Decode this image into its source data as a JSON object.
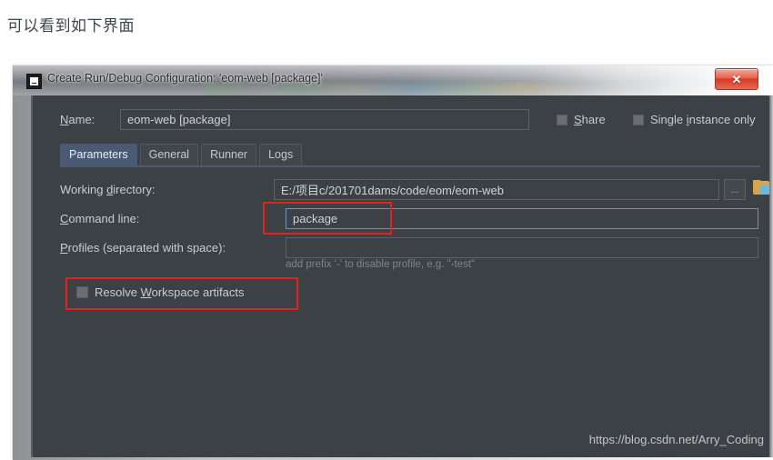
{
  "page": {
    "heading": "可以看到如下界面"
  },
  "window": {
    "title": "Create Run/Debug Configuration: 'eom-web [package]'",
    "app_icon": "intellij-idea-icon",
    "close_label": "✕"
  },
  "form": {
    "name_label_pre": "N",
    "name_label_post": "ame:",
    "name_value": "eom-web [package]",
    "share": {
      "label_pre": "S",
      "label_post": "hare",
      "checked": false
    },
    "single_instance": {
      "label_pre": "Single ",
      "label_mnemonic": "i",
      "label_post": "nstance only",
      "checked": false
    }
  },
  "tabs": [
    {
      "label": "Parameters",
      "active": true
    },
    {
      "label": "General",
      "active": false
    },
    {
      "label": "Runner",
      "active": false
    },
    {
      "label": "Logs",
      "active": false
    }
  ],
  "parameters": {
    "working_directory": {
      "label_pre": "Working ",
      "label_mnemonic": "d",
      "label_post": "irectory:",
      "value": "E:/项目c/201701dams/code/eom/eom-web",
      "browse_button": "...",
      "folder_icon": "folder-icon"
    },
    "command_line": {
      "label_pre": "C",
      "label_post": "ommand line:",
      "value": "package",
      "focused": true
    },
    "profiles": {
      "label_pre": "P",
      "label_post": "rofiles (separated with space):",
      "value": "",
      "hint": "add prefix '-' to disable profile, e.g. \"-test\""
    },
    "resolve_workspace": {
      "label_pre": "Resolve ",
      "label_mnemonic": "W",
      "label_post": "orkspace artifacts",
      "checked": false
    }
  },
  "annotations": [
    {
      "name": "command-line-highlight",
      "color": "#e5211c"
    },
    {
      "name": "resolve-workspace-highlight",
      "color": "#e5211c"
    }
  ],
  "watermark": "https://blog.csdn.net/Arry_Coding",
  "colors": {
    "dialog_bg": "#3c4145",
    "accent_tab": "#4a5a74",
    "focus_border": "#6a91c0",
    "annotation_red": "#e5211c",
    "folder_orange": "#d9a44c"
  }
}
